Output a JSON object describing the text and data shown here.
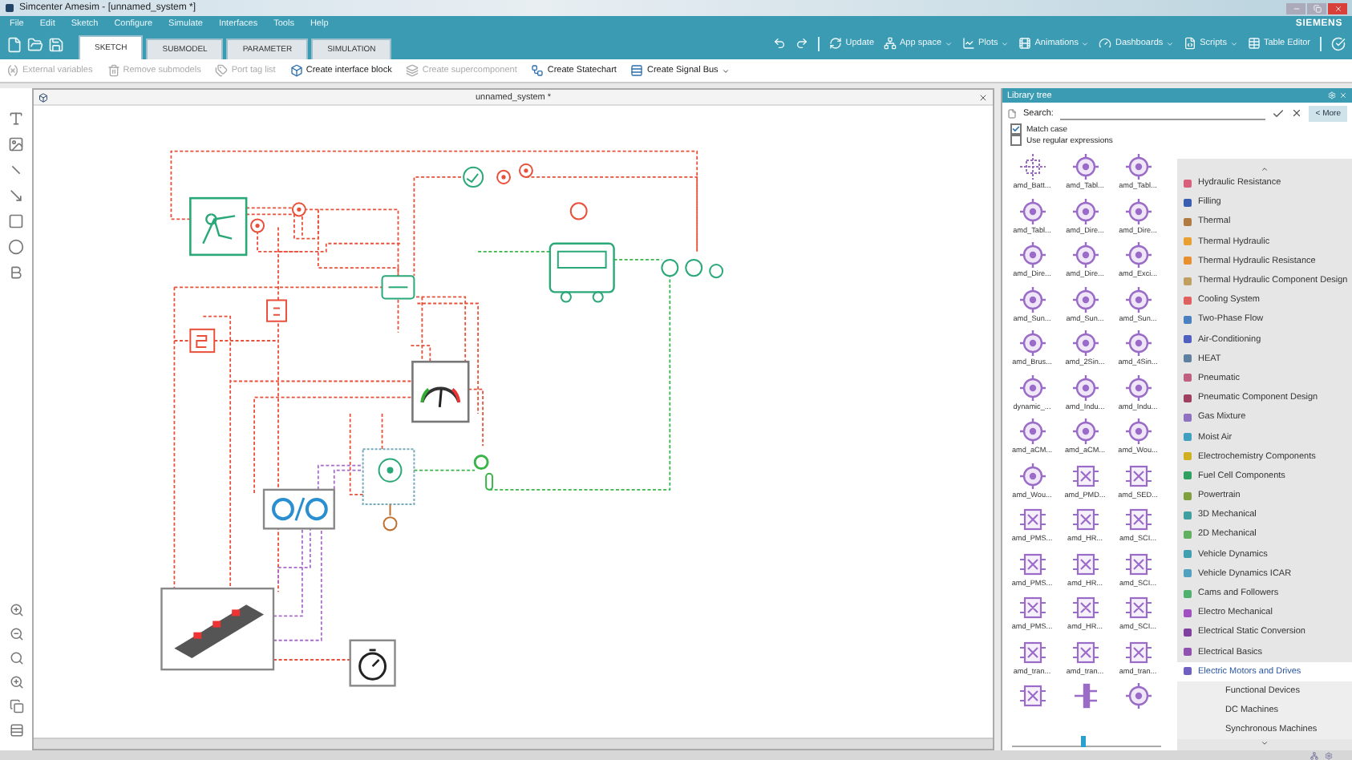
{
  "window": {
    "title": "Simcenter Amesim - [unnamed_system *]"
  },
  "menu": [
    "File",
    "Edit",
    "Sketch",
    "Configure",
    "Simulate",
    "Interfaces",
    "Tools",
    "Help"
  ],
  "brand": "SIEMENS",
  "ribbon_tabs": [
    {
      "label": "SKETCH",
      "selected": true
    },
    {
      "label": "SUBMODEL",
      "selected": false
    },
    {
      "label": "PARAMETER",
      "selected": false
    },
    {
      "label": "SIMULATION",
      "selected": false
    }
  ],
  "ribbon_actions": [
    {
      "kind": "update",
      "label": "Update",
      "dropdown": false
    },
    {
      "kind": "app",
      "label": "App space",
      "dropdown": true
    },
    {
      "kind": "plots",
      "label": "Plots",
      "dropdown": true
    },
    {
      "kind": "animations",
      "label": "Animations",
      "dropdown": true
    },
    {
      "kind": "dashboards",
      "label": "Dashboards",
      "dropdown": true
    },
    {
      "kind": "scripts",
      "label": "Scripts",
      "dropdown": true
    },
    {
      "kind": "table",
      "label": "Table Editor",
      "dropdown": false
    }
  ],
  "toolbar": [
    {
      "kind": "variables",
      "label": "External variables",
      "disabled": true,
      "dropdown": false
    },
    {
      "kind": "remove",
      "label": "Remove submodels",
      "disabled": true,
      "dropdown": false
    },
    {
      "kind": "tags",
      "label": "Port tag list",
      "disabled": true,
      "dropdown": false
    },
    {
      "kind": "interface",
      "label": "Create interface block",
      "disabled": false,
      "dropdown": false
    },
    {
      "kind": "super",
      "label": "Create supercomponent",
      "disabled": true,
      "dropdown": false
    },
    {
      "kind": "statechart",
      "label": "Create Statechart",
      "disabled": false,
      "dropdown": false
    },
    {
      "kind": "bus",
      "label": "Create Signal Bus",
      "disabled": false,
      "dropdown": true
    }
  ],
  "document": {
    "title": "unnamed_system *"
  },
  "library": {
    "title": "Library tree",
    "search_label": "Search:",
    "more_button": "< More",
    "options": [
      {
        "label": "Match case",
        "checked": true
      },
      {
        "label": "Use regular expressions",
        "checked": false
      }
    ],
    "components": [
      {
        "kind": "junction",
        "label": "amd_Batt..."
      },
      {
        "kind": "round",
        "label": "amd_Tabl..."
      },
      {
        "kind": "round",
        "label": "amd_Tabl..."
      },
      {
        "kind": "round",
        "label": "amd_Tabl..."
      },
      {
        "kind": "round",
        "label": "amd_Dire..."
      },
      {
        "kind": "round",
        "label": "amd_Dire..."
      },
      {
        "kind": "round",
        "label": "amd_Dire..."
      },
      {
        "kind": "round",
        "label": "amd_Dire..."
      },
      {
        "kind": "round",
        "label": "amd_Exci..."
      },
      {
        "kind": "round",
        "label": "amd_Sun..."
      },
      {
        "kind": "round",
        "label": "amd_Sun..."
      },
      {
        "kind": "round",
        "label": "amd_Sun..."
      },
      {
        "kind": "round",
        "label": "amd_Brus..."
      },
      {
        "kind": "round",
        "label": "amd_2Sin..."
      },
      {
        "kind": "round",
        "label": "amd_4Sin..."
      },
      {
        "kind": "round",
        "label": "dynamic_..."
      },
      {
        "kind": "round",
        "label": "amd_Indu..."
      },
      {
        "kind": "round",
        "label": "amd_Indu..."
      },
      {
        "kind": "round",
        "label": "amd_aCM..."
      },
      {
        "kind": "round",
        "label": "amd_aCM..."
      },
      {
        "kind": "round",
        "label": "amd_Wou..."
      },
      {
        "kind": "round",
        "label": "amd_Wou..."
      },
      {
        "kind": "square",
        "label": "amd_PMD..."
      },
      {
        "kind": "square",
        "label": "amd_SED..."
      },
      {
        "kind": "square",
        "label": "amd_PMS..."
      },
      {
        "kind": "square",
        "label": "amd_HR..."
      },
      {
        "kind": "square",
        "label": "amd_SCI..."
      },
      {
        "kind": "square",
        "label": "amd_PMS..."
      },
      {
        "kind": "square",
        "label": "amd_HR..."
      },
      {
        "kind": "square",
        "label": "amd_SCI..."
      },
      {
        "kind": "square",
        "label": "amd_PMS..."
      },
      {
        "kind": "square",
        "label": "amd_HR..."
      },
      {
        "kind": "square",
        "label": "amd_SCI..."
      },
      {
        "kind": "square",
        "label": "amd_tran..."
      },
      {
        "kind": "square",
        "label": "amd_tran..."
      },
      {
        "kind": "square",
        "label": "amd_tran..."
      },
      {
        "kind": "square"
      },
      {
        "kind": "bar"
      },
      {
        "kind": "round"
      }
    ],
    "zoom_slider": {
      "level": 0.46
    },
    "categories": [
      {
        "label": "Hydraulic Resistance",
        "color": "#d8607a",
        "selected": false
      },
      {
        "label": "Filling",
        "color": "#3a5fb0",
        "selected": false
      },
      {
        "label": "Thermal",
        "color": "#b07a40",
        "selected": false
      },
      {
        "label": "Thermal Hydraulic",
        "color": "#e8a030",
        "selected": false
      },
      {
        "label": "Thermal Hydraulic Resistance",
        "color": "#e89030",
        "selected": false
      },
      {
        "label": "Thermal Hydraulic Component Design",
        "color": "#c0a060",
        "selected": false
      },
      {
        "label": "Cooling System",
        "color": "#e06060",
        "selected": false
      },
      {
        "label": "Two-Phase Flow",
        "color": "#4a80c0",
        "selected": false
      },
      {
        "label": "Air-Conditioning",
        "color": "#5060c0",
        "selected": false
      },
      {
        "label": "HEAT",
        "color": "#6080a0",
        "selected": false
      },
      {
        "label": "Pneumatic",
        "color": "#c06080",
        "selected": false
      },
      {
        "label": "Pneumatic Component Design",
        "color": "#a04060",
        "selected": false
      },
      {
        "label": "Gas Mixture",
        "color": "#9070c0",
        "selected": false
      },
      {
        "label": "Moist Air",
        "color": "#40a0c0",
        "selected": false
      },
      {
        "label": "Electrochemistry Components",
        "color": "#d0b020",
        "selected": false
      },
      {
        "label": "Fuel Cell Components",
        "color": "#30a060",
        "selected": false
      },
      {
        "label": "Powertrain",
        "color": "#80a040",
        "selected": false
      },
      {
        "label": "3D Mechanical",
        "color": "#40a0a0",
        "selected": false
      },
      {
        "label": "2D Mechanical",
        "color": "#60b060",
        "selected": false
      },
      {
        "label": "Vehicle Dynamics",
        "color": "#40a0b0",
        "selected": false
      },
      {
        "label": "Vehicle Dynamics ICAR",
        "color": "#50a0c0",
        "selected": false
      },
      {
        "label": "Cams and Followers",
        "color": "#50b070",
        "selected": false
      },
      {
        "label": "Electro Mechanical",
        "color": "#a050c0",
        "selected": false
      },
      {
        "label": "Electrical Static Conversion",
        "color": "#8040a0",
        "selected": false
      },
      {
        "label": "Electrical Basics",
        "color": "#9050b0",
        "selected": false
      },
      {
        "label": "Electric Motors and Drives",
        "color": "#7060c0",
        "selected": true,
        "children": [
          {
            "label": "Functional Devices",
            "selected": false
          },
          {
            "label": "DC Machines",
            "selected": false
          },
          {
            "label": "Synchronous Machines",
            "selected": false
          }
        ]
      }
    ]
  }
}
